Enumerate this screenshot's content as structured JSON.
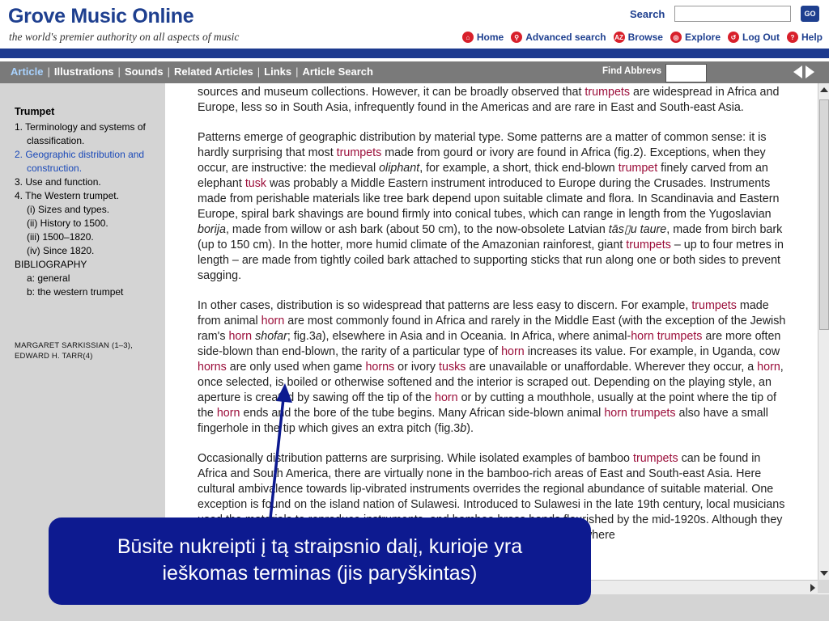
{
  "header": {
    "logo": "Grove Music Online",
    "tagline": "the world's premier authority on all aspects of music",
    "search_label": "Search",
    "search_value": "",
    "go_label": "GO",
    "nav": [
      {
        "label": "Home",
        "icon": "home-icon",
        "glyph": "⌂"
      },
      {
        "label": "Advanced search",
        "icon": "magnifier-icon",
        "glyph": "⚲"
      },
      {
        "label": "Browse",
        "icon": "az-icon",
        "glyph": "AZ"
      },
      {
        "label": "Explore",
        "icon": "explore-icon",
        "glyph": "◎"
      },
      {
        "label": "Log Out",
        "icon": "logout-icon",
        "glyph": "↺"
      },
      {
        "label": "Help",
        "icon": "help-icon",
        "glyph": "?"
      }
    ],
    "brand_color": "#1e3f8f",
    "icon_color": "#d8202b"
  },
  "tabbar": {
    "tabs": [
      "Article",
      "Illustrations",
      "Sounds",
      "Related Articles",
      "Links",
      "Article Search"
    ],
    "active_tab": "Article",
    "find_abbrevs_label": "Find Abbrevs",
    "find_abbrevs_value": ""
  },
  "sidebar": {
    "title": "Trumpet",
    "items": [
      {
        "label": "1. Terminology and systems of classification.",
        "level": 0,
        "current": false
      },
      {
        "label": "2. Geographic distribution and construction.",
        "level": 0,
        "current": true
      },
      {
        "label": "3. Use and function.",
        "level": 0,
        "current": false
      },
      {
        "label": "4. The Western trumpet.",
        "level": 0,
        "current": false
      },
      {
        "label": "(i) Sizes and types.",
        "level": 1,
        "current": false
      },
      {
        "label": "(ii) History to 1500.",
        "level": 1,
        "current": false
      },
      {
        "label": "(iii) 1500–1820.",
        "level": 1,
        "current": false
      },
      {
        "label": "(iv) Since 1820.",
        "level": 1,
        "current": false
      },
      {
        "label": "BIBLIOGRAPHY",
        "level": 0,
        "current": false
      },
      {
        "label": "a: general",
        "level": 1,
        "current": false
      },
      {
        "label": "b: the western trumpet",
        "level": 1,
        "current": false
      }
    ],
    "authors": "MARGARET SARKISSIAN (1–3), EDWARD H. TARR(4)"
  },
  "article": {
    "paragraphs": [
      [
        {
          "t": "sources and museum collections. However, it can be broadly observed that "
        },
        {
          "t": "trumpets",
          "k": "term"
        },
        {
          "t": " are widespread in Africa and Europe, less so in South Asia, infrequently found in the Americas and are rare in East and South-east Asia."
        }
      ],
      [
        {
          "t": "Patterns emerge of geographic distribution by material type. Some patterns are a matter of common sense: it is hardly surprising that most "
        },
        {
          "t": "trumpets",
          "k": "term"
        },
        {
          "t": " made from gourd or ivory are found in Africa (fig.2). Exceptions, when they occur, are instructive: the medieval "
        },
        {
          "t": "oliphant",
          "k": "i"
        },
        {
          "t": ", for example, a short, thick end-blown "
        },
        {
          "t": "trumpet",
          "k": "term"
        },
        {
          "t": " finely carved from an elephant "
        },
        {
          "t": "tusk",
          "k": "term"
        },
        {
          "t": " was probably a Middle Eastern instrument introduced to Europe during the Crusades. Instruments made from perishable materials like tree bark depend upon suitable climate and flora. In Scandinavia and Eastern Europe, spiral bark shavings are bound firmly into conical tubes, which can range in length from the Yugoslavian "
        },
        {
          "t": "borija",
          "k": "i"
        },
        {
          "t": ", made from willow or ash bark (about 50 cm), to the now-obsolete Latvian "
        },
        {
          "t": "tās▯u taure",
          "k": "i"
        },
        {
          "t": ", made from birch bark (up to 150 cm). In the hotter, more humid climate of the Amazonian rainforest, giant "
        },
        {
          "t": "trumpets",
          "k": "term"
        },
        {
          "t": " – up to four metres in length – are made from tightly coiled bark attached to supporting sticks that run along one or both sides to prevent sagging."
        }
      ],
      [
        {
          "t": "In other cases, distribution is so widespread that patterns are less easy to discern. For example, "
        },
        {
          "t": "trumpets",
          "k": "term"
        },
        {
          "t": " made from animal "
        },
        {
          "t": "horn",
          "k": "term"
        },
        {
          "t": " are most commonly found in Africa and rarely in the Middle East (with the exception of the Jewish ram's "
        },
        {
          "t": "horn",
          "k": "term"
        },
        {
          "t": " "
        },
        {
          "t": "shofar",
          "k": "i"
        },
        {
          "t": "; fig.3"
        },
        {
          "t": "a",
          "k": "i"
        },
        {
          "t": "), elsewhere in Asia and in Oceania. In Africa, where animal-"
        },
        {
          "t": "horn trumpets",
          "k": "term"
        },
        {
          "t": " are more often side-blown than end-blown, the rarity of a particular type of "
        },
        {
          "t": "horn",
          "k": "term"
        },
        {
          "t": " increases its value. For example, in Uganda, cow "
        },
        {
          "t": "horns",
          "k": "term"
        },
        {
          "t": " are only used when game "
        },
        {
          "t": "horns",
          "k": "term"
        },
        {
          "t": " or ivory "
        },
        {
          "t": "tusks",
          "k": "term"
        },
        {
          "t": " are unavailable or unaffordable. Wherever they occur, a "
        },
        {
          "t": "horn",
          "k": "term"
        },
        {
          "t": ", once selected, is boiled or otherwise softened and the interior is scraped out. Depending on the playing style, an aperture is created by sawing off the tip of the "
        },
        {
          "t": "horn",
          "k": "term"
        },
        {
          "t": " or by cutting a mouthhole, usually at the point where the tip of the "
        },
        {
          "t": "horn",
          "k": "term"
        },
        {
          "t": " ends and the bore of the tube begins. Many African side-blown animal "
        },
        {
          "t": "horn trumpets",
          "k": "term"
        },
        {
          "t": " also have a small fingerhole in the tip which gives an extra pitch (fig.3"
        },
        {
          "t": "b",
          "k": "i"
        },
        {
          "t": ")."
        }
      ],
      [
        {
          "t": "Occasionally distribution patterns are surprising. While isolated examples of bamboo "
        },
        {
          "t": "trumpets",
          "k": "term"
        },
        {
          "t": " can be found in Africa and South America, there are virtually none in the bamboo-rich areas of East and South-east Asia. Here cultural ambivalence towards lip-vibrated instruments overrides the regional abundance of suitable material. One exception is found on the island nation of Sulawesi. Introduced to Sulawesi in the late 19th century, local musicians used the materials to reproduce instruments, and bamboo brass bands flourished by the mid-1920s. Although they soon declined, they survived in the Minahasa highlands north of Minahasa, where"
        }
      ]
    ],
    "term_color": "#9b0e3a"
  },
  "callout": {
    "text": "Būsite nukreipti į tą straipsnio dalį, kurioje yra ieškomas terminas (jis paryškintas)",
    "background": "#0d1a90"
  }
}
